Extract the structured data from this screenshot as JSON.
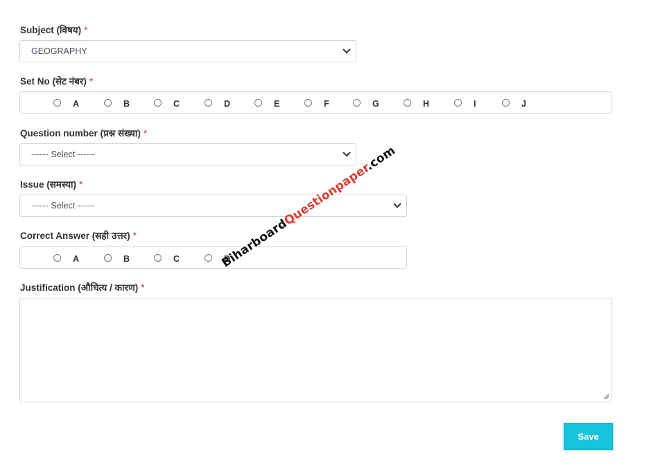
{
  "subject": {
    "label": "Subject (विषय)",
    "required": "*",
    "value": "GEOGRAPHY"
  },
  "set_no": {
    "label": "Set No (सेट नंबर)",
    "required": "*",
    "options": [
      "A",
      "B",
      "C",
      "D",
      "E",
      "F",
      "G",
      "H",
      "I",
      "J"
    ]
  },
  "question_number": {
    "label": "Question number (प्रश्न संख्या)",
    "required": "*",
    "value": "------ Select ------"
  },
  "issue": {
    "label": "Issue (समस्या)",
    "required": "*",
    "value": "------ Select ------"
  },
  "correct_answer": {
    "label": "Correct Answer (सही उत्तर)",
    "required": "*",
    "options": [
      "A",
      "B",
      "C",
      "D"
    ]
  },
  "justification": {
    "label": "Justification (औचित्य / कारण)",
    "required": "*",
    "value": ""
  },
  "save_button": {
    "label": "Save"
  },
  "watermark": {
    "part1": "Biharboard",
    "part2": "Questionpaper",
    "part3": ".com"
  },
  "colors": {
    "accent": "#17c4dc",
    "required": "#e0245e",
    "border": "#ced4da"
  },
  "icons": {
    "dropdown": "chevron-down-icon",
    "resize": "resize-handle-icon"
  }
}
